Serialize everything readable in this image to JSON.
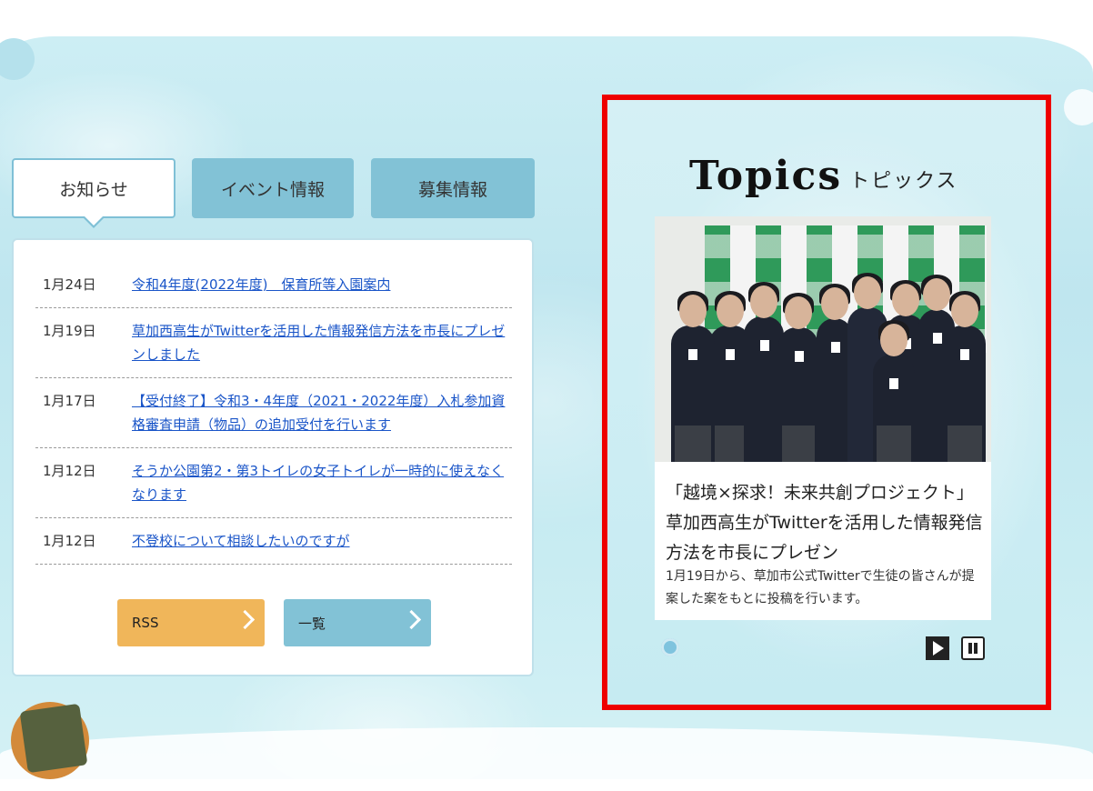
{
  "tabs": [
    {
      "label": "お知らせ",
      "active": true
    },
    {
      "label": "イベント情報",
      "active": false
    },
    {
      "label": "募集情報",
      "active": false
    }
  ],
  "news": [
    {
      "date": "1月24日",
      "title": "令和4年度(2022年度)　保育所等入園案内"
    },
    {
      "date": "1月19日",
      "title": "草加西高生がTwitterを活用した情報発信方法を市長にプレゼンしました"
    },
    {
      "date": "1月17日",
      "title": "【受付終了】令和3・4年度（2021・2022年度）入札参加資格審査申請（物品）の追加受付を行います"
    },
    {
      "date": "1月12日",
      "title": "そうか公園第2・第3トイレの女子トイレが一時的に使えなくなります"
    },
    {
      "date": "1月12日",
      "title": "不登校について相談したいのですが"
    }
  ],
  "buttons": {
    "rss": "RSS",
    "list": "一覧"
  },
  "topics": {
    "heading_en": "Topics",
    "heading_ja": "トピックス",
    "card_title": "「越境×探求！未来共創プロジェクト」草加西高生がTwitterを活用した情報発信方法を市長にプレゼン",
    "card_body": "1月19日から、草加市公式Twitterで生徒の皆さんが提案した案をもとに投稿を行います。",
    "photo_icon": "group-photo-students-and-mayor"
  },
  "colors": {
    "tab_inactive": "#82c2d6",
    "rss_button": "#f0b65a",
    "link": "#1a55c8",
    "highlight_frame": "#ee0000"
  }
}
